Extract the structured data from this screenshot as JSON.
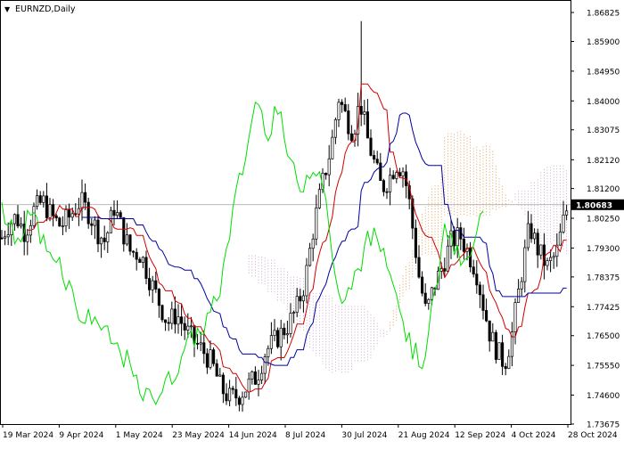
{
  "window": {
    "title": "EURNZD,Daily",
    "menu_glyph": "▼"
  },
  "colors": {
    "background": "#ffffff",
    "frame": "#000000",
    "candle": "#000000",
    "tenkan": "#d00000",
    "kijun": "#0000a0",
    "chikou": "#00dd00",
    "senkou_a": "#e0a060",
    "senkou_b": "#c8a8c8",
    "price_label_bg": "#000000",
    "price_label_fg": "#ffffff",
    "current_price_line": "#a0a0a0"
  },
  "chart_data": {
    "type": "candlestick",
    "symbol": "EURNZD",
    "timeframe": "Daily",
    "indicator": "Ichimoku Kinko Hyo",
    "y_axis": {
      "ticks": [
        1.86825,
        1.859,
        1.8495,
        1.84,
        1.83075,
        1.8212,
        1.812,
        1.8025,
        1.793,
        1.78375,
        1.77425,
        1.765,
        1.7555,
        1.746,
        1.73675
      ],
      "tick_labels": [
        "1.86825",
        "1.85900",
        "1.84950",
        "1.84000",
        "1.83075",
        "1.82120",
        "1.81200",
        "1.80250",
        "1.79300",
        "1.78375",
        "1.77425",
        "1.76500",
        "1.75550",
        "1.74600",
        "1.73675"
      ],
      "range": [
        1.73675,
        1.86825
      ]
    },
    "x_axis": {
      "tick_labels": [
        "19 Mar 2024",
        "9 Apr 2024",
        "1 May 2024",
        "23 May 2024",
        "14 Jun 2024",
        "8 Jul 2024",
        "30 Jul 2024",
        "21 Aug 2024",
        "12 Sep 2024",
        "4 Oct 2024",
        "28 Oct 2024"
      ]
    },
    "current_price": 1.80683,
    "current_price_label": "1.80683",
    "approximate_close_by_tick": {
      "19 Mar 2024": 1.795,
      "9 Apr 2024": 1.806,
      "1 May 2024": 1.796,
      "23 May 2024": 1.772,
      "14 Jun 2024": 1.748,
      "8 Jul 2024": 1.773,
      "30 Jul 2024": 1.832,
      "21 Aug 2024": 1.789,
      "12 Sep 2024": 1.768,
      "4 Oct 2024": 1.792,
      "28 Oct 2024": 1.807
    },
    "grid": false
  }
}
